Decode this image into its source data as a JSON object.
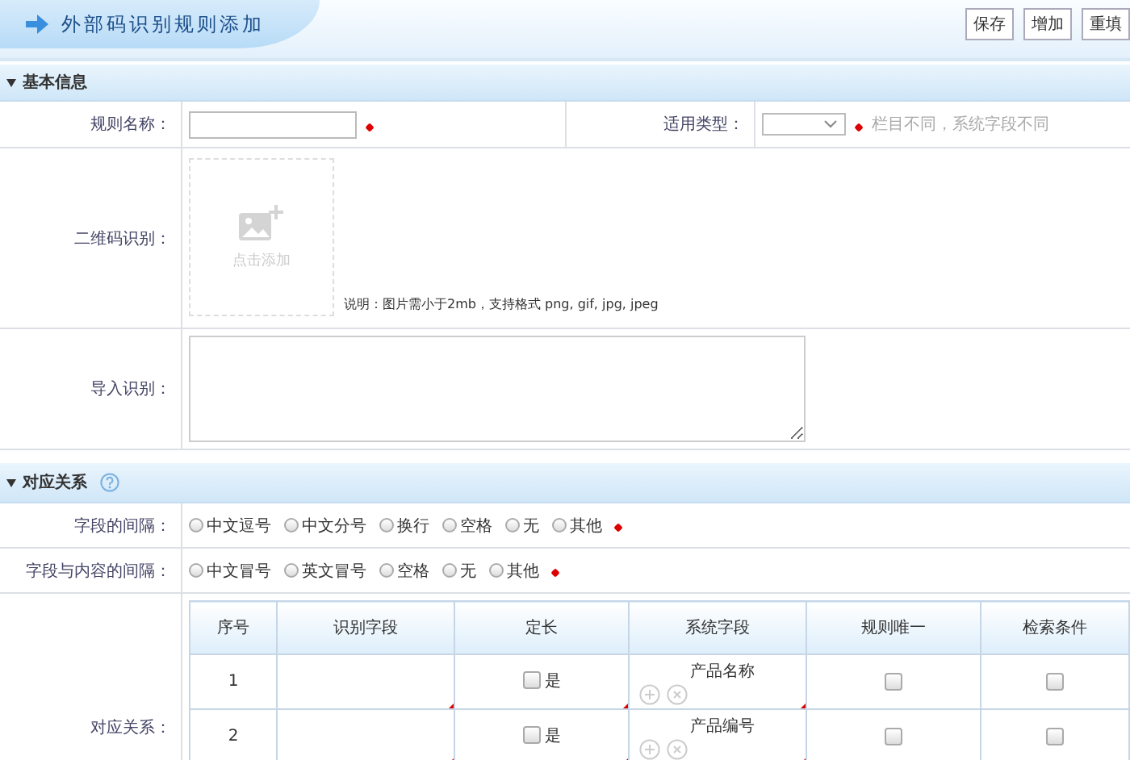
{
  "header": {
    "title": "外部码识别规则添加",
    "buttons": [
      "保存",
      "增加",
      "重填"
    ]
  },
  "basic_section": {
    "title": "基本信息",
    "expanded": true,
    "rule_name": {
      "label": "规则名称：",
      "required": true
    },
    "type": {
      "label": "适用类型：",
      "required": true,
      "hint": "栏目不同，系统字段不同"
    },
    "qr": {
      "label": "二维码识别：",
      "upload_text": "点击添加",
      "note": "说明：图片需小于2mb，支持格式 png, gif, jpg, jpeg"
    },
    "import": {
      "label": "导入识别："
    }
  },
  "mapping_section": {
    "title": "对应关系",
    "expanded": true,
    "field_separator": {
      "label": "字段的间隔：",
      "required": true,
      "options": [
        {
          "label": "中文逗号",
          "selected": false
        },
        {
          "label": "中文分号",
          "selected": false
        },
        {
          "label": "换行",
          "selected": false
        },
        {
          "label": "空格",
          "selected": false
        },
        {
          "label": "无",
          "selected": false
        },
        {
          "label": "其他",
          "selected": false
        }
      ]
    },
    "content_separator": {
      "label": "字段与内容的间隔：",
      "required": true,
      "options": [
        {
          "label": "中文冒号",
          "selected": false
        },
        {
          "label": "英文冒号",
          "selected": false
        },
        {
          "label": "空格",
          "selected": false
        },
        {
          "label": "无",
          "selected": false
        },
        {
          "label": "其他",
          "selected": false
        }
      ]
    },
    "table": {
      "label": "对应关系：",
      "columns": [
        "序号",
        "识别字段",
        "定长",
        "系统字段",
        "规则唯一",
        "检索条件"
      ],
      "rows": [
        {
          "index": "1",
          "fixed": false,
          "fixed_label": "是",
          "system_field": "产品名称",
          "unique": false,
          "search": false
        },
        {
          "index": "2",
          "fixed": false,
          "fixed_label": "是",
          "system_field": "产品编号",
          "unique": false,
          "search": false
        }
      ]
    }
  }
}
